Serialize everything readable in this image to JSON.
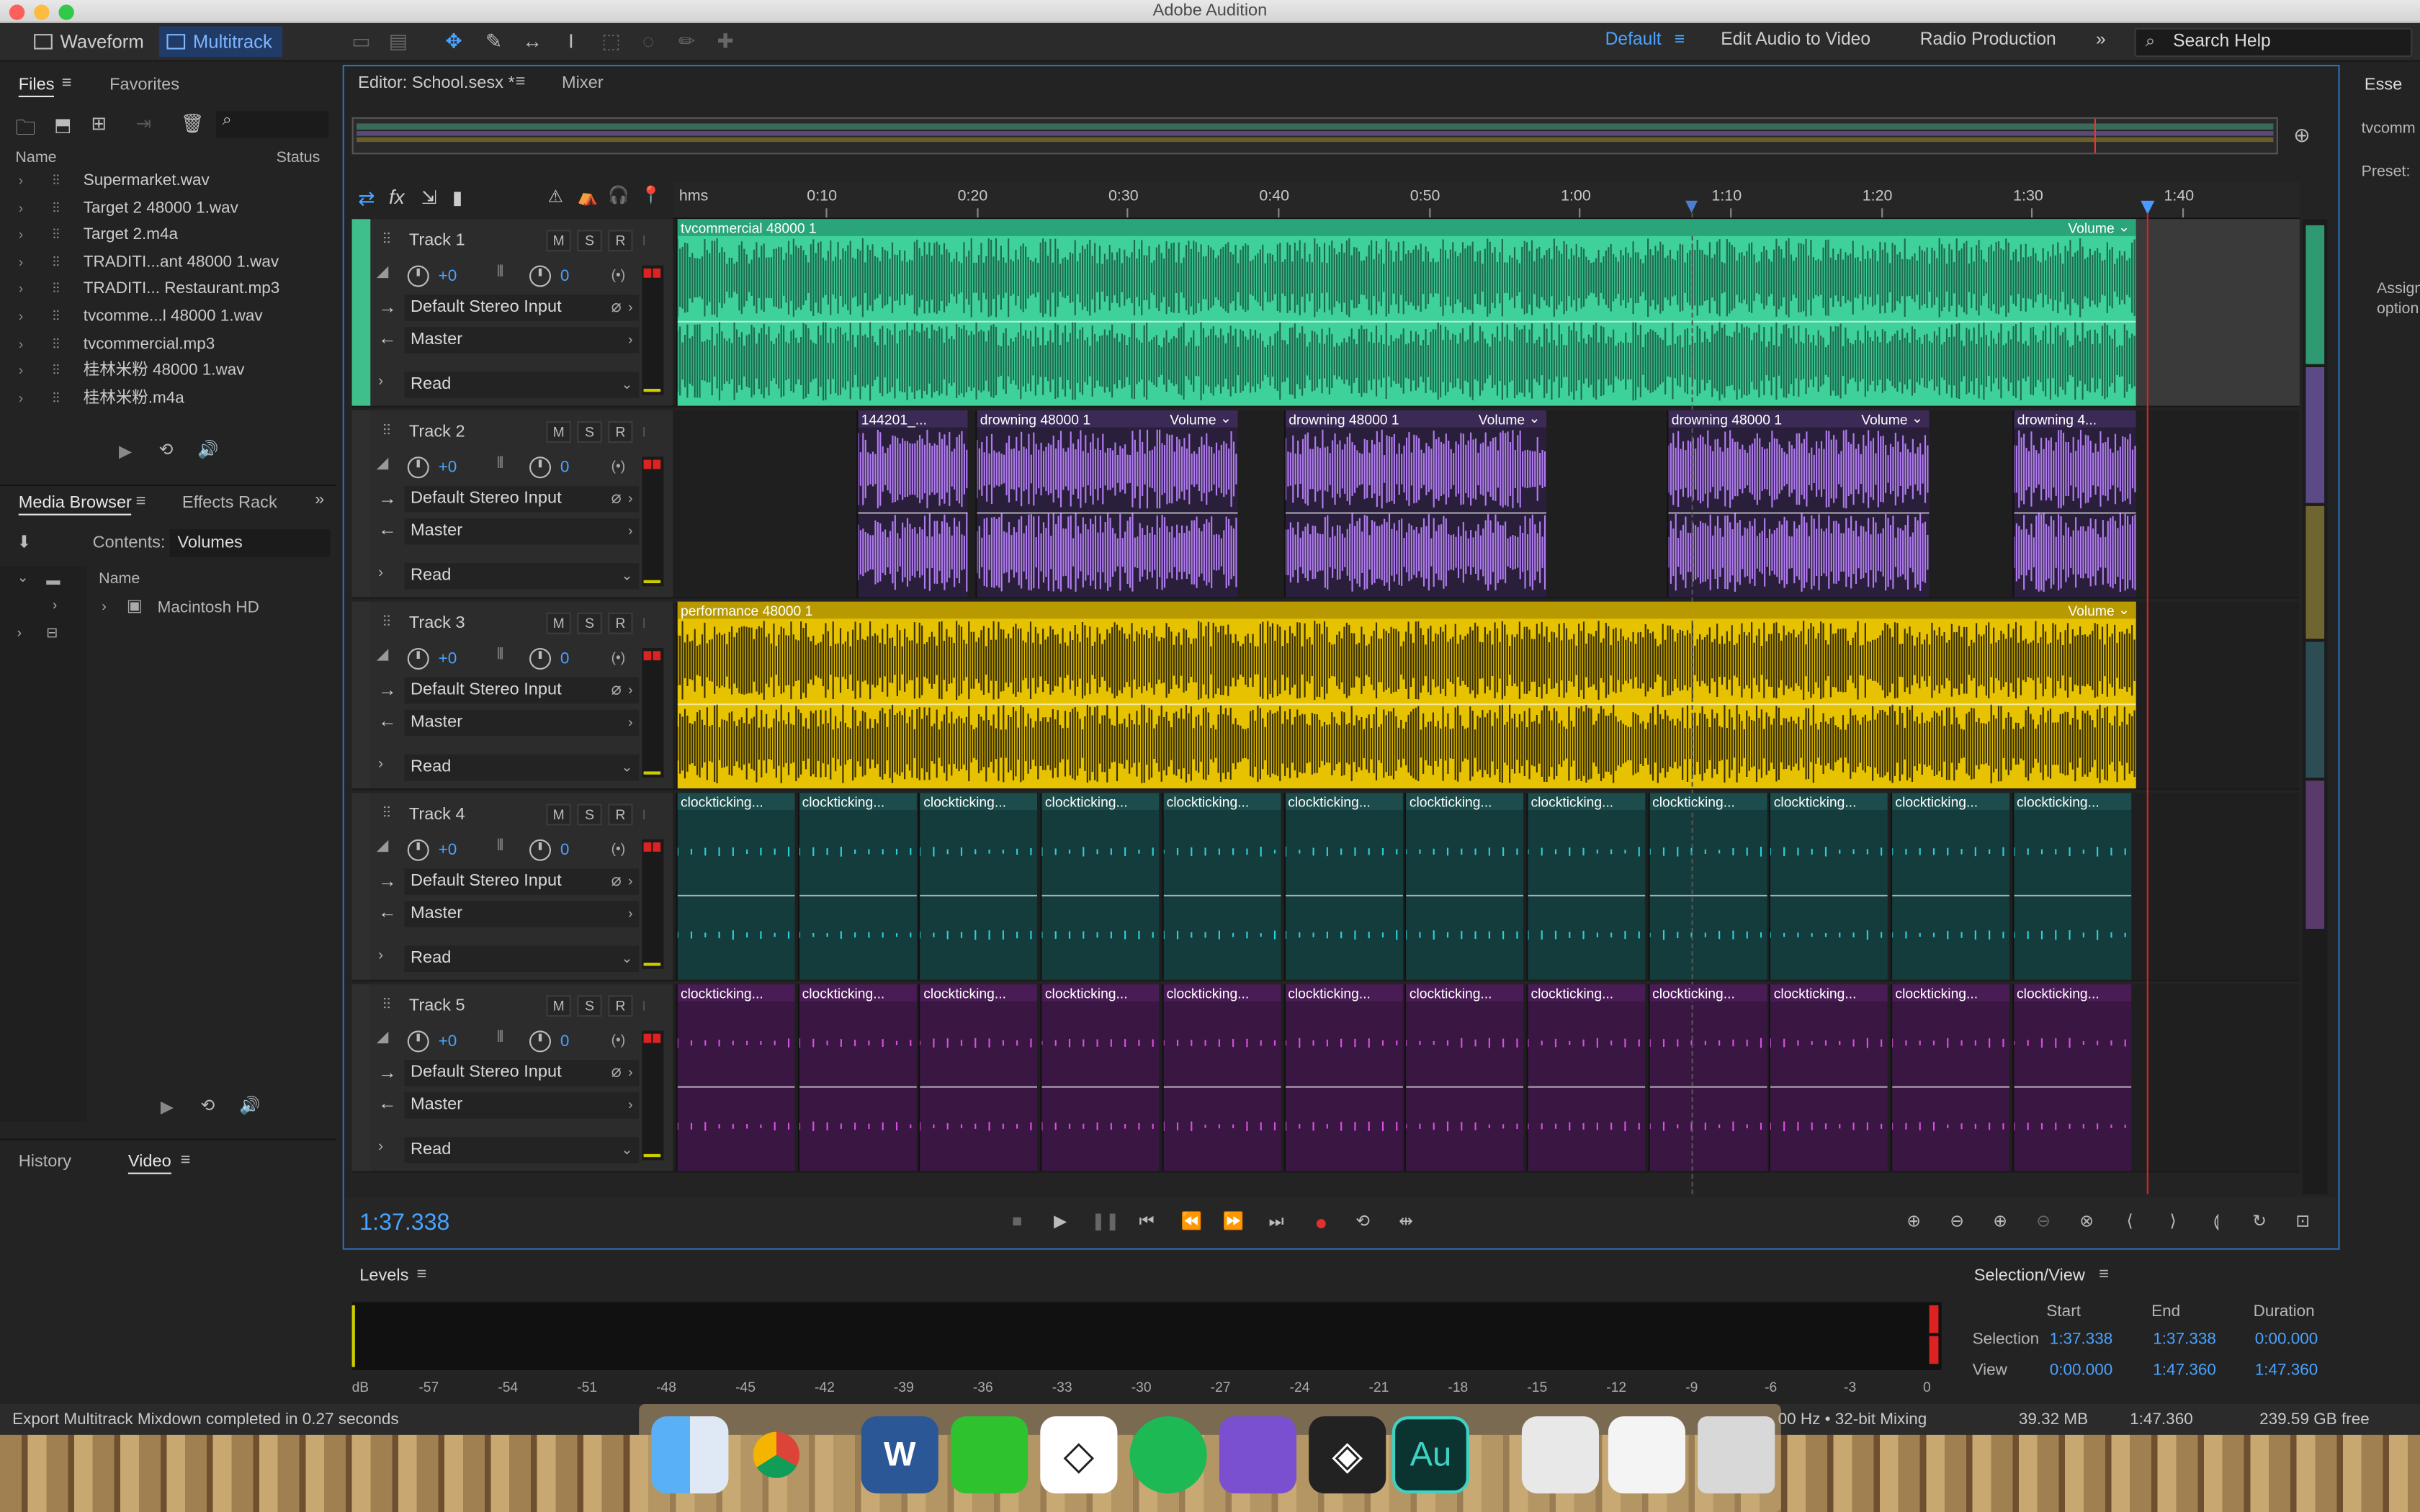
{
  "window_title": "Adobe Audition",
  "modes": {
    "waveform": "Waveform",
    "multitrack": "Multitrack"
  },
  "workspaces": {
    "default": "Default",
    "edit_audio_to_video": "Edit Audio to Video",
    "radio_production": "Radio Production",
    "overflow": "»"
  },
  "search": {
    "placeholder": "Search Help"
  },
  "files_panel": {
    "tab_files": "Files",
    "tab_favorites": "Favorites",
    "col_name": "Name",
    "col_status": "Status",
    "items": [
      "Supermarket.wav",
      "Target 2 48000 1.wav",
      "Target 2.m4a",
      "TRADITI...ant 48000 1.wav",
      "TRADITI... Restaurant.mp3",
      "tvcomme...l 48000 1.wav",
      "tvcommercial.mp3",
      "桂林米粉 48000 1.wav",
      "桂林米粉.m4a"
    ]
  },
  "media_browser": {
    "tab_media": "Media Browser",
    "tab_effects": "Effects Rack",
    "contents_label": "Contents:",
    "contents_value": "Volumes",
    "col_name": "Name",
    "item": "Macintosh HD"
  },
  "history_panel": {
    "tab_history": "History",
    "tab_video": "Video"
  },
  "editor": {
    "tab_editor": "Editor: School.sesx *",
    "tab_mixer": "Mixer"
  },
  "ruler": {
    "labels": [
      "hms",
      "0:10",
      "0:20",
      "0:30",
      "0:40",
      "0:50",
      "1:00",
      "1:10",
      "1:20",
      "1:30",
      "1:40"
    ]
  },
  "tracks": [
    {
      "name": "Track 1",
      "vol": "+0",
      "pan": "0",
      "input": "Default Stereo Input",
      "output": "Master",
      "mode": "Read",
      "color": "#3fd19a"
    },
    {
      "name": "Track 2",
      "vol": "+0",
      "pan": "0",
      "input": "Default Stereo Input",
      "output": "Master",
      "mode": "Read",
      "color": "#a570e8"
    },
    {
      "name": "Track 3",
      "vol": "+0",
      "pan": "0",
      "input": "Default Stereo Input",
      "output": "Master",
      "mode": "Read",
      "color": "#e6c200"
    },
    {
      "name": "Track 4",
      "vol": "+0",
      "pan": "0",
      "input": "Default Stereo Input",
      "output": "Master",
      "mode": "Read",
      "color": "#1c6f73"
    },
    {
      "name": "Track 5",
      "vol": "+0",
      "pan": "0",
      "input": "Default Stereo Input",
      "output": "Master",
      "mode": "Read",
      "color": "#a23fb4"
    }
  ],
  "clips": {
    "t1": {
      "label": "tvcommercial 48000 1",
      "vol": "Volume"
    },
    "t2": [
      {
        "label": "144201_..."
      },
      {
        "label": "drowning 48000 1",
        "vol": "Volume"
      },
      {
        "label": "drowning 48000 1",
        "vol": "Volume"
      },
      {
        "label": "drowning 48000 1",
        "vol": "Volume"
      },
      {
        "label": "drowning 4..."
      }
    ],
    "t3": {
      "label": "performance 48000 1",
      "vol": "Volume"
    },
    "tick_label": "clockticking..."
  },
  "mic_symbol": "M",
  "solo_symbol": "S",
  "rec_symbol": "R",
  "time_display": "1:37.338",
  "levels": {
    "title": "Levels",
    "scale": [
      "dB",
      "-57",
      "-54",
      "-51",
      "-48",
      "-45",
      "-42",
      "-39",
      "-36",
      "-33",
      "-30",
      "-27",
      "-24",
      "-21",
      "-18",
      "-15",
      "-12",
      "-9",
      "-6",
      "-3",
      "0"
    ]
  },
  "selection_view": {
    "title": "Selection/View",
    "col_start": "Start",
    "col_end": "End",
    "col_duration": "Duration",
    "row_selection": "Selection",
    "row_view": "View",
    "sel_start": "1:37.338",
    "sel_end": "1:37.338",
    "sel_duration": "0:00.000",
    "view_start": "0:00.000",
    "view_end": "1:47.360",
    "view_duration": "1:47.360"
  },
  "status": {
    "message": "Export Multitrack Mixdown completed in 0.27 seconds",
    "mixing": "00 Hz • 32-bit Mixing",
    "memory": "39.32 MB",
    "duration": "1:47.360",
    "free": "239.59 GB free"
  },
  "right_panel": {
    "title": "Esse",
    "file": "tvcomm",
    "preset": "Preset:",
    "assign": "Assign",
    "option": "option"
  }
}
